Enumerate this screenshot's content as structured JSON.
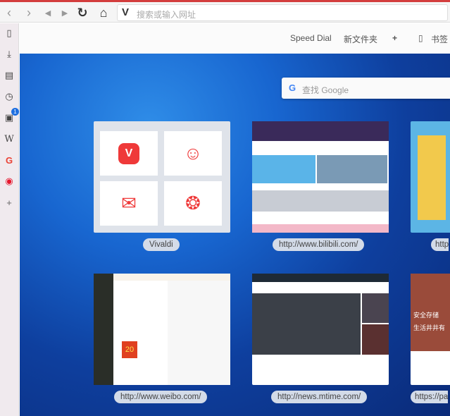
{
  "toolbar": {
    "url_placeholder": "搜索或输入网址",
    "vivaldi_logo": "V",
    "icons": [
      "back-icon",
      "forward-icon",
      "rewind-icon",
      "fast-forward-icon",
      "reload-icon",
      "home-icon"
    ]
  },
  "sidebar": {
    "items": [
      {
        "icon": "bookmark-icon"
      },
      {
        "icon": "download-icon"
      },
      {
        "icon": "notes-icon"
      },
      {
        "icon": "history-icon"
      },
      {
        "icon": "window-icon",
        "badge": "1"
      },
      {
        "icon": "wikipedia-icon",
        "glyph": "W"
      },
      {
        "icon": "google-icon",
        "glyph": "G"
      },
      {
        "icon": "weibo-icon"
      },
      {
        "icon": "add-icon",
        "glyph": "+"
      }
    ]
  },
  "header": {
    "tabs": [
      {
        "label": "Speed Dial",
        "active": true
      },
      {
        "label": "新文件夹"
      },
      {
        "label": "+"
      },
      {
        "label": "书签"
      }
    ]
  },
  "search": {
    "placeholder": "查找 Google",
    "logo": "G"
  },
  "dials": [
    {
      "label": "Vivaldi",
      "type": "folder"
    },
    {
      "label": "http://www.bilibili.com/"
    },
    {
      "label": "http"
    },
    {
      "label": "http://www.weibo.com/",
      "badge": "20"
    },
    {
      "label": "http://news.mtime.com/"
    },
    {
      "label": "https://pa",
      "text1": "安全存储",
      "text2": "生活井井有"
    }
  ],
  "colors": {
    "accent": "#1c5ea8",
    "vivaldi_red": "#ef3939",
    "topbar": "#d33d3d"
  }
}
